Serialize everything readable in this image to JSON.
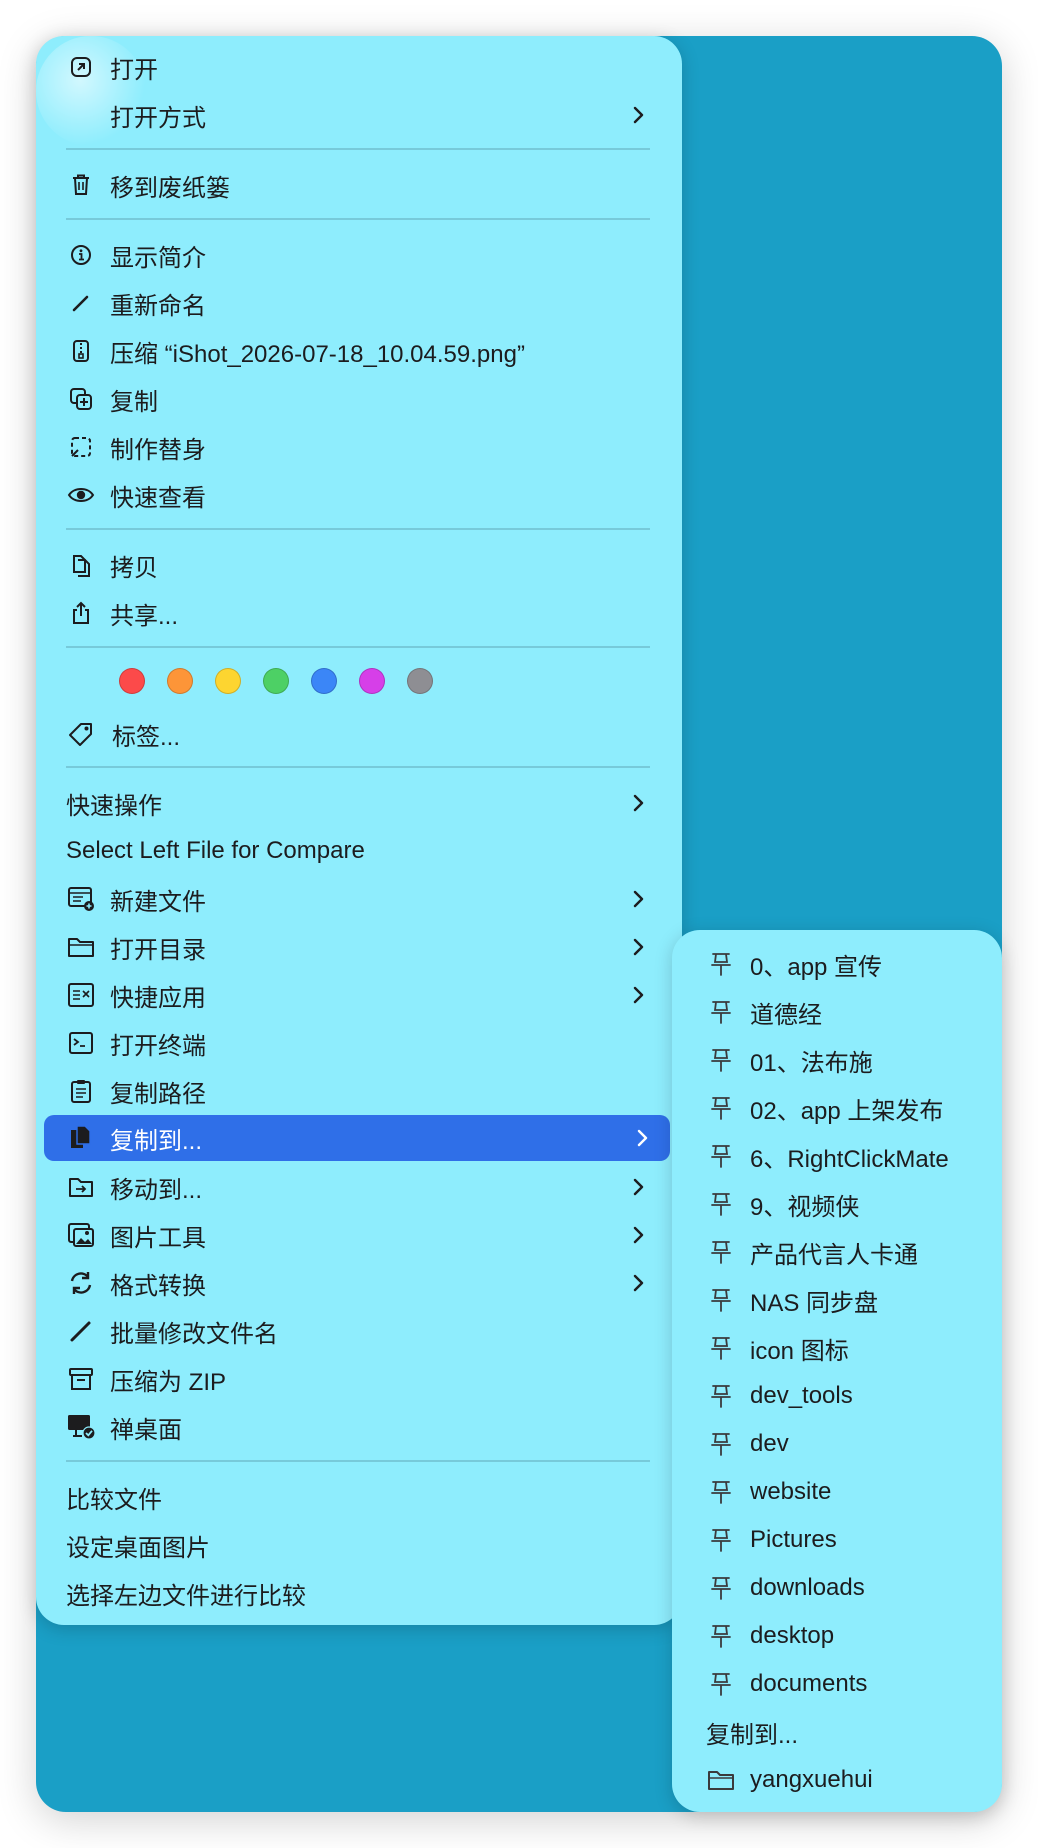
{
  "menu": {
    "open": "打开",
    "open_with": "打开方式",
    "move_to_trash": "移到废纸篓",
    "get_info": "显示简介",
    "rename": "重新命名",
    "compress": "压缩 “iShot_2026-07-18_10.04.59.png”",
    "duplicate": "复制",
    "make_alias": "制作替身",
    "quick_look": "快速查看",
    "copy": "拷贝",
    "share": "共享...",
    "tags": "标签...",
    "tag_colors": [
      "#fc4a4a",
      "#fd9538",
      "#fdd530",
      "#4dd065",
      "#3b86f7",
      "#d63fe8",
      "#8e8e93"
    ],
    "quick_actions": "快速操作",
    "select_left_file": "Select Left File for Compare",
    "new_file": "新建文件",
    "open_directory": "打开目录",
    "quick_apps": "快捷应用",
    "open_terminal": "打开终端",
    "copy_path": "复制路径",
    "copy_to": "复制到...",
    "move_to": "移动到...",
    "image_tools": "图片工具",
    "format_convert": "格式转换",
    "batch_rename": "批量修改文件名",
    "compress_zip": "压缩为 ZIP",
    "zen_desktop": "禅桌面",
    "compare_files": "比较文件",
    "set_desktop_picture": "设定桌面图片",
    "select_left_compare": "选择左边文件进行比较"
  },
  "submenu": {
    "items": [
      "0、app 宣传",
      "道德经",
      "01、法布施",
      "02、app 上架发布",
      "6、RightClickMate",
      "9、视频侠",
      "产品代言人卡通",
      "NAS 同步盘",
      "icon 图标",
      "dev_tools",
      "dev",
      "website",
      "Pictures",
      "downloads",
      "desktop",
      "documents"
    ],
    "copy_to_label": "复制到...",
    "home_folder": "yangxuehui"
  }
}
